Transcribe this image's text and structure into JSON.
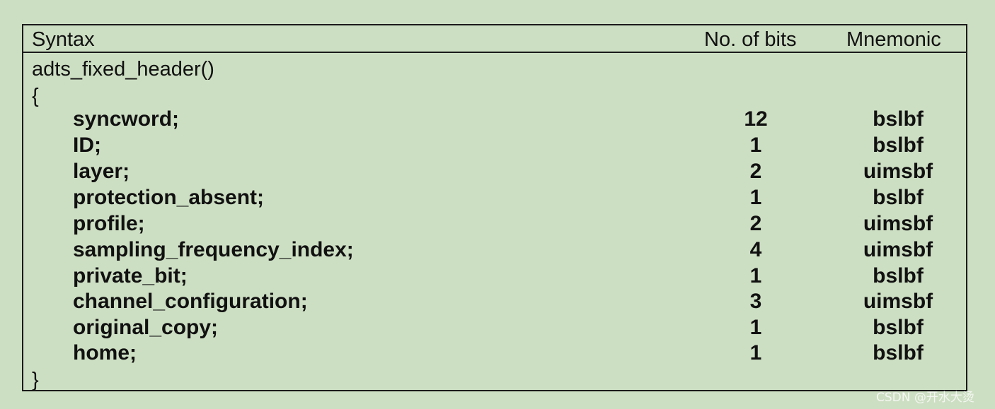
{
  "table": {
    "headers": {
      "syntax": "Syntax",
      "bits": "No. of bits",
      "mnemonic": "Mnemonic"
    },
    "function_name": "adts_fixed_header()",
    "open_brace": "{",
    "close_brace": "}",
    "rows": [
      {
        "name": "syncword;",
        "bits": "12",
        "mnemonic": "bslbf"
      },
      {
        "name": "ID;",
        "bits": "1",
        "mnemonic": "bslbf"
      },
      {
        "name": "layer;",
        "bits": "2",
        "mnemonic": "uimsbf"
      },
      {
        "name": "protection_absent;",
        "bits": "1",
        "mnemonic": "bslbf"
      },
      {
        "name": "profile;",
        "bits": "2",
        "mnemonic": "uimsbf"
      },
      {
        "name": "sampling_frequency_index;",
        "bits": "4",
        "mnemonic": "uimsbf"
      },
      {
        "name": "private_bit;",
        "bits": "1",
        "mnemonic": "bslbf"
      },
      {
        "name": "channel_configuration;",
        "bits": "3",
        "mnemonic": "uimsbf"
      },
      {
        "name": "original_copy;",
        "bits": "1",
        "mnemonic": "bslbf"
      },
      {
        "name": "home;",
        "bits": "1",
        "mnemonic": "bslbf"
      }
    ]
  },
  "watermark": "CSDN @开水大烫"
}
